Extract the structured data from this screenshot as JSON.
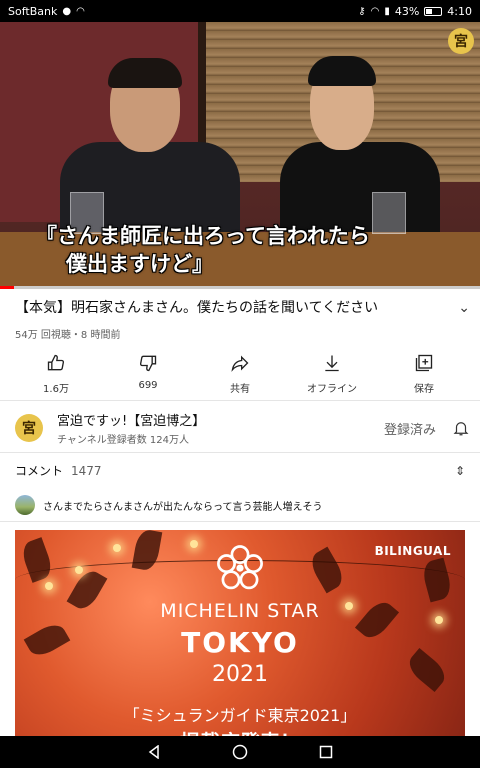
{
  "status_bar": {
    "carrier": "SoftBank",
    "battery": "43%",
    "battery_level": 0.43,
    "time": "4:10"
  },
  "video": {
    "caption_line1": "『さんま師匠に出ろって言われたら",
    "caption_line2": "僕出ますけど』",
    "channel_badge": "宮",
    "progress": 0.03
  },
  "details": {
    "title": "【本気】明石家さんまさん。僕たちの話を聞いてください",
    "meta": "54万 回視聴・8 時間前"
  },
  "actions": [
    {
      "icon": "thumbs-up-icon",
      "label": "1.6万"
    },
    {
      "icon": "thumbs-down-icon",
      "label": "699"
    },
    {
      "icon": "share-icon",
      "label": "共有"
    },
    {
      "icon": "download-icon",
      "label": "オフライン"
    },
    {
      "icon": "save-playlist-icon",
      "label": "保存"
    }
  ],
  "channel": {
    "avatar": "宮",
    "name": "宮迫ですッ!【宮迫博之】",
    "subscribers": "チャンネル登録者数 124万人",
    "subscribed_label": "登録済み"
  },
  "comments": {
    "title": "コメント",
    "count": "1477",
    "top_comment": "さんまでたらさんまさんが出たんならって言う芸能人増えそう"
  },
  "ad": {
    "bilingual": "BILINGUAL",
    "line1": "MICHELIN STAR",
    "line2": "TOKYO",
    "line3": "2021",
    "line4": "「ミシュランガイド東京2021」",
    "line5": "掲載店発表！"
  },
  "colors": {
    "accent": "#ff0000",
    "badge": "#e8c44c"
  }
}
